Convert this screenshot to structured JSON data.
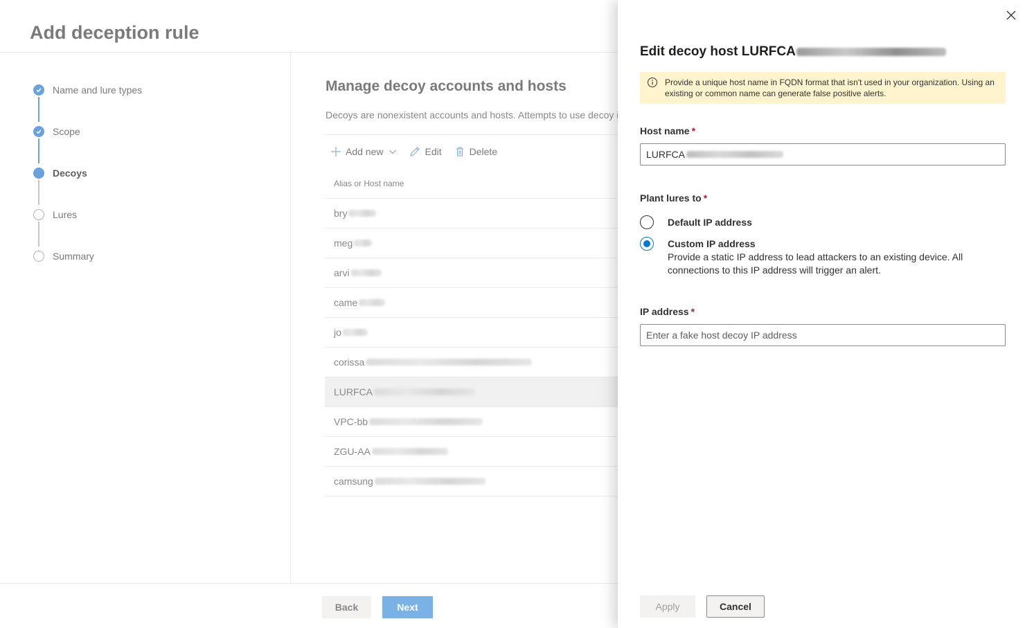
{
  "wizard": {
    "title": "Add deception rule",
    "steps": [
      {
        "label": "Name and lure types",
        "state": "done"
      },
      {
        "label": "Scope",
        "state": "done"
      },
      {
        "label": "Decoys",
        "state": "current"
      },
      {
        "label": "Lures",
        "state": "todo"
      },
      {
        "label": "Summary",
        "state": "todo"
      }
    ],
    "content": {
      "title": "Manage decoy accounts and hosts",
      "description": "Decoys are nonexistent accounts and hosts. Attempts to use decoy i",
      "toolbar": {
        "add_new": "Add new",
        "edit": "Edit",
        "delete": "Delete"
      },
      "table": {
        "column_header": "Alias or Host name",
        "rows": [
          {
            "prefix": "bry",
            "selected": false
          },
          {
            "prefix": "meg",
            "selected": false
          },
          {
            "prefix": "arvi",
            "selected": false
          },
          {
            "prefix": "came",
            "selected": false
          },
          {
            "prefix": "jo",
            "selected": false
          },
          {
            "prefix": "corissa",
            "selected": false
          },
          {
            "prefix": "LURFCA",
            "selected": true
          },
          {
            "prefix": "VPC-bb",
            "selected": false
          },
          {
            "prefix": "ZGU-AA",
            "selected": false
          },
          {
            "prefix": "camsung",
            "selected": false
          }
        ]
      }
    },
    "footer": {
      "back": "Back",
      "next": "Next"
    }
  },
  "panel": {
    "title_prefix": "Edit decoy host LURFCA",
    "warning": "Provide a unique host name in FQDN format that isn't used in your organization. Using an existing or common name can generate false positive alerts.",
    "host_name": {
      "label": "Host name",
      "required_mark": "*",
      "value_prefix": "LURFCA"
    },
    "plant_lures": {
      "label": "Plant lures to",
      "required_mark": "*",
      "options": [
        {
          "label": "Default IP address",
          "selected": false,
          "description": ""
        },
        {
          "label": "Custom IP address",
          "selected": true,
          "description": "Provide a static IP address to lead attackers to an existing device. All connections to this IP address will trigger an alert."
        }
      ]
    },
    "ip_address": {
      "label": "IP address",
      "required_mark": "*",
      "placeholder": "Enter a fake host decoy IP address",
      "value": ""
    },
    "buttons": {
      "apply": "Apply",
      "cancel": "Cancel"
    }
  },
  "colors": {
    "accent": "#0078d4",
    "step_active": "#6aa2dc",
    "warning_bg": "#fff4ce",
    "required": "#a4262c"
  }
}
